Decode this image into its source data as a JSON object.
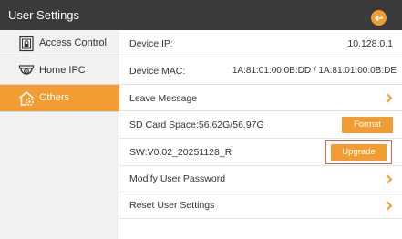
{
  "header": {
    "title": "User Settings",
    "back_icon": "back-arrow-icon",
    "accent_color": "#f39c32"
  },
  "sidebar": {
    "items": [
      {
        "label": "Access Control",
        "icon": "door-lock-icon",
        "active": false
      },
      {
        "label": "Home IPC",
        "icon": "dome-camera-icon",
        "active": false
      },
      {
        "label": "Others",
        "icon": "home-gear-icon",
        "active": true
      }
    ]
  },
  "settings": {
    "device_ip": {
      "label": "Device IP:",
      "value": "10.128.0.1"
    },
    "device_mac": {
      "label": "Device MAC:",
      "value": "1A:81:01:00:0B:DD / 1A:81:01:00:0B:DE"
    },
    "leave_message": {
      "label": "Leave Message"
    },
    "sd_card": {
      "label": "SD Card Space:56.62G/56.97G",
      "button": "Format"
    },
    "software": {
      "label": "SW:V0.02_20251128_R",
      "button": "Upgrade"
    },
    "modify_password": {
      "label": "Modify User Password"
    },
    "reset_settings": {
      "label": "Reset User Settings"
    }
  }
}
